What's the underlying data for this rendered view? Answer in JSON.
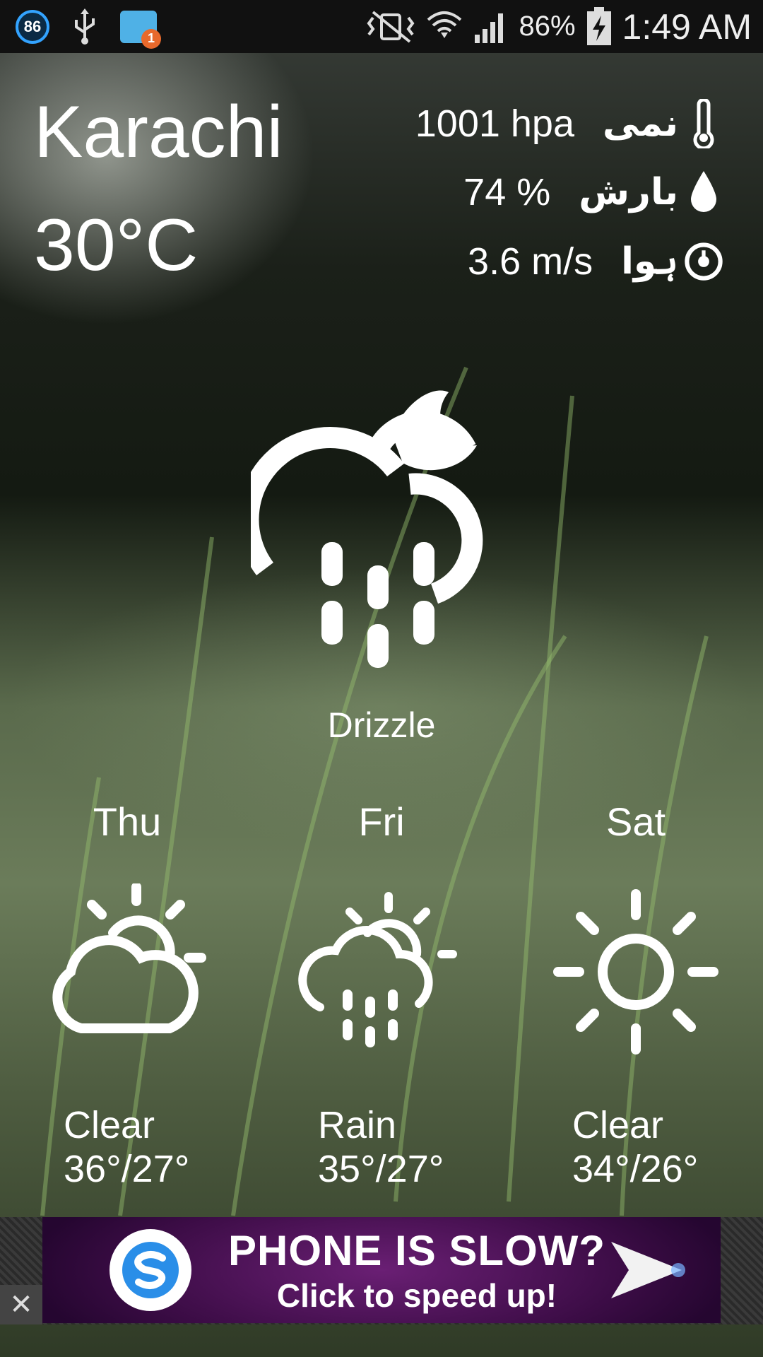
{
  "status_bar": {
    "notification_badge": "86",
    "message_count": "1",
    "battery": "86%",
    "time": "1:49 AM",
    "icons": [
      "notification-86-icon",
      "usb-icon",
      "messages-icon",
      "vibrate-mute-icon",
      "wifi-icon",
      "signal-icon",
      "battery-charging-icon"
    ]
  },
  "current": {
    "city": "Karachi",
    "temperature": "30°C",
    "condition": "Drizzle",
    "icon": "moon-cloud-rain-icon"
  },
  "stats": [
    {
      "value": "1001 hpa",
      "label": "نمی",
      "icon": "thermometer-icon"
    },
    {
      "value": "74 %",
      "label": "بارش",
      "icon": "droplet-icon"
    },
    {
      "value": "3.6 m/s",
      "label": "ہوا",
      "icon": "wind-icon"
    }
  ],
  "forecast": [
    {
      "day": "Thu",
      "condition": "Clear",
      "range": "36°/27°",
      "icon": "partly-cloudy-icon"
    },
    {
      "day": "Fri",
      "condition": "Rain",
      "range": "35°/27°",
      "icon": "sun-cloud-rain-icon"
    },
    {
      "day": "Sat",
      "condition": "Clear",
      "range": "34°/26°",
      "icon": "sun-icon"
    }
  ],
  "ad": {
    "title": "PHONE IS SLOW?",
    "subtitle": "Click to speed up!",
    "close_symbol": "✕"
  },
  "colors": {
    "status_bar_bg": "#111111",
    "ad_bg": "#3b0c45",
    "badge_ring": "#33a3ff",
    "message_badge": "#e8692c"
  }
}
